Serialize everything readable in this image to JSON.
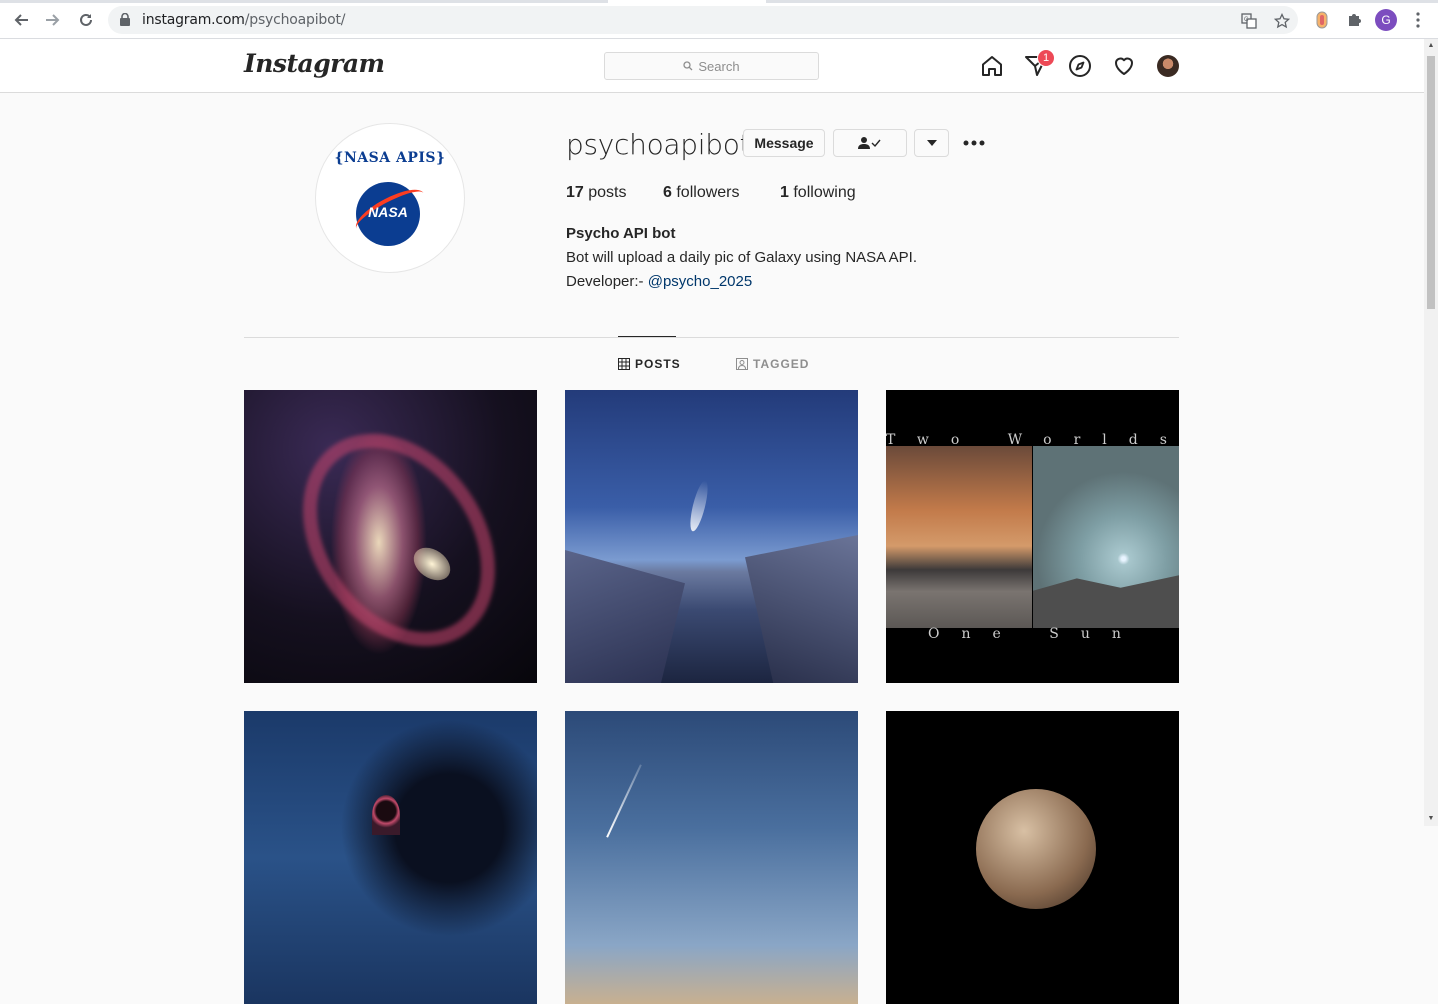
{
  "browser": {
    "url_domain": "instagram.com",
    "url_path": "/psychoapibot/",
    "profile_initial": "G"
  },
  "header": {
    "logo": "Instagram",
    "search_placeholder": "Search",
    "notification_count": "1"
  },
  "profile": {
    "username": "psychoapibot",
    "message_label": "Message",
    "avatar_text_top": "{NASA APIS}",
    "avatar_text_meatball": "NASA",
    "stats": {
      "posts_count": "17",
      "posts_label": "posts",
      "followers_count": "6",
      "followers_label": "followers",
      "following_count": "1",
      "following_label": "following"
    },
    "full_name": "Psycho API bot",
    "bio": "Bot will upload a daily pic of Galaxy using NASA API.",
    "developer_prefix": "Developer:-",
    "developer_handle": "@psycho_2025"
  },
  "tabs": [
    {
      "label": "POSTS",
      "active": true
    },
    {
      "label": "TAGGED",
      "active": false
    }
  ],
  "posts": {
    "post3_title_top": "Two Worlds",
    "post3_title_bottom": "One Sun"
  },
  "colors": {
    "badge": "#ed4956",
    "link": "#00376b",
    "chrome_profile": "#7c4dbf"
  }
}
